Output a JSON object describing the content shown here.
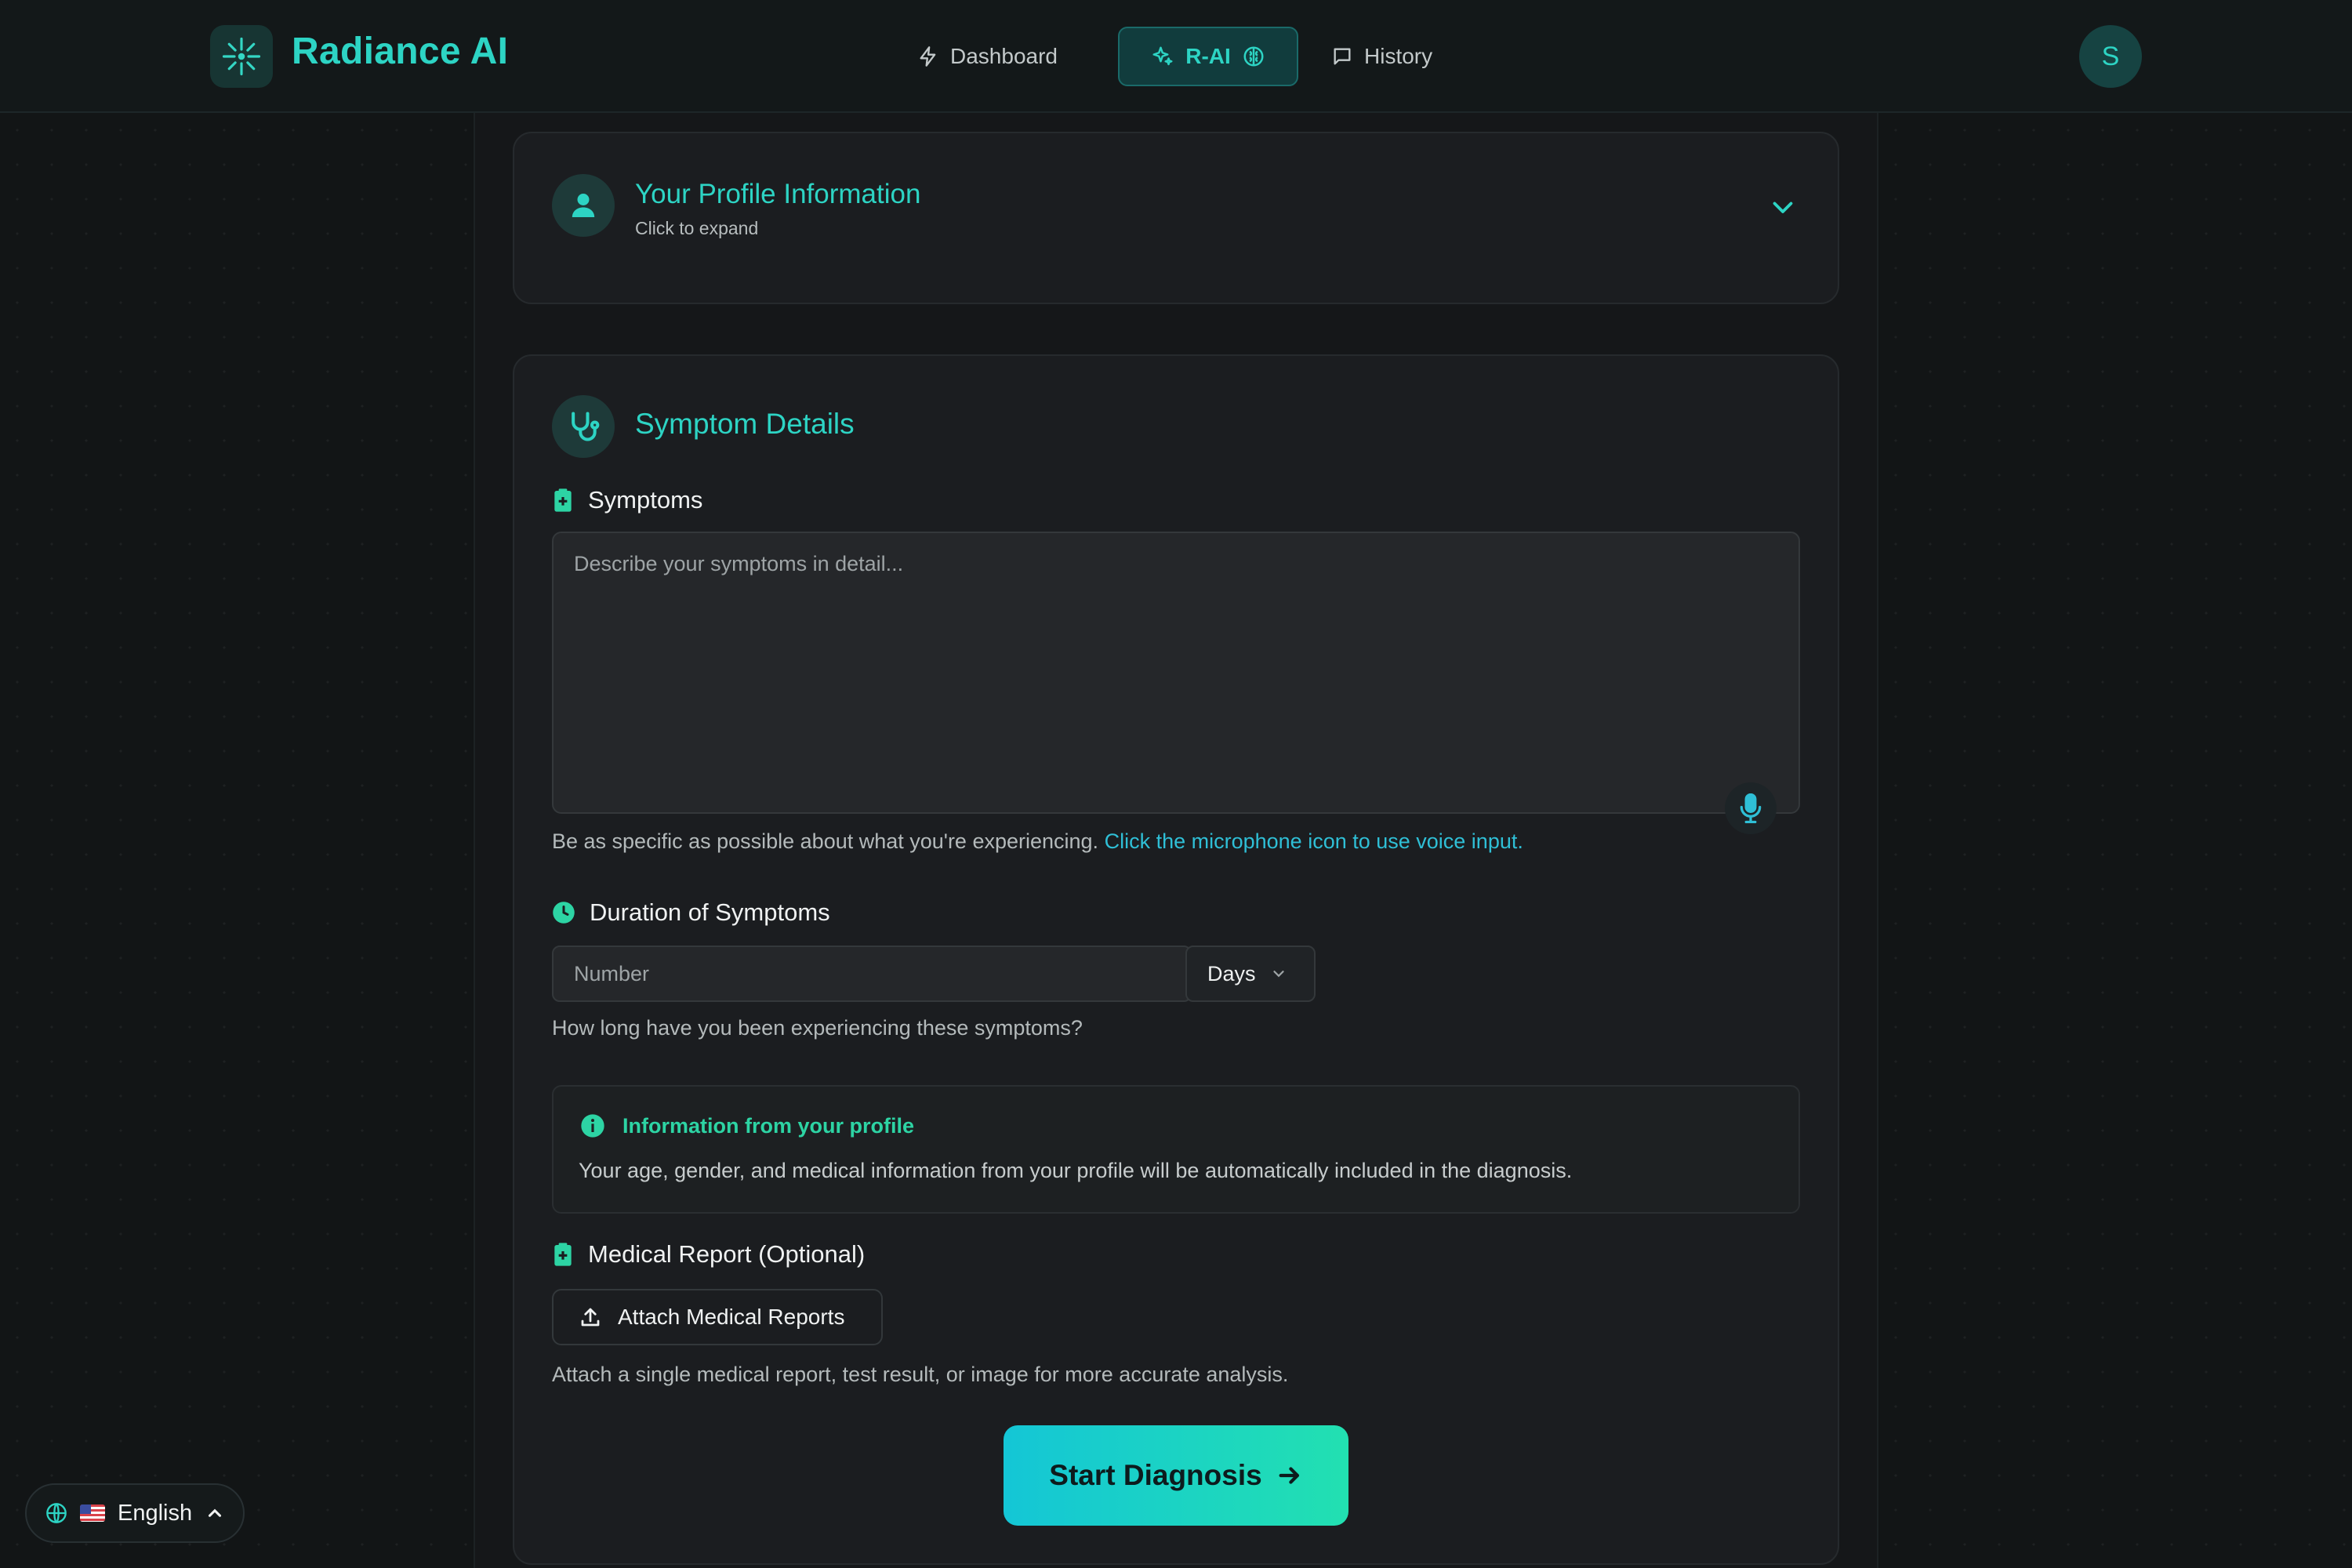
{
  "app": {
    "name": "Radiance AI"
  },
  "nav": {
    "items": [
      {
        "label": "Dashboard",
        "icon": "lightning-icon"
      },
      {
        "label": "R-AI",
        "icon": "sparkles-icon",
        "active": true
      },
      {
        "label": "History",
        "icon": "message-icon"
      }
    ]
  },
  "user": {
    "initial": "S"
  },
  "profile_card": {
    "title": "Your Profile Information",
    "subtitle": "Click to expand"
  },
  "symptom_card": {
    "title": "Symptom Details",
    "symptoms_label": "Symptoms",
    "symptoms_placeholder": "Describe your symptoms in detail...",
    "symptoms_help": "Be as specific as possible about what you're experiencing.",
    "symptoms_help_link": "Click the microphone icon to use voice input.",
    "duration_label": "Duration of Symptoms",
    "duration_placeholder": "Number",
    "duration_unit": "Days",
    "duration_help": "How long have you been experiencing these symptoms?",
    "info_title": "Information from your profile",
    "info_text": "Your age, gender, and medical information from your profile will be automatically included in the diagnosis.",
    "report_label": "Medical Report (Optional)",
    "attach_button": "Attach Medical Reports",
    "report_help": "Attach a single medical report, test result, or image for more accurate analysis.",
    "start_button": "Start Diagnosis"
  },
  "language": {
    "label": "English"
  },
  "colors": {
    "accent": "#2dd4c4",
    "background": "#101314",
    "card": "#1b1d20"
  }
}
